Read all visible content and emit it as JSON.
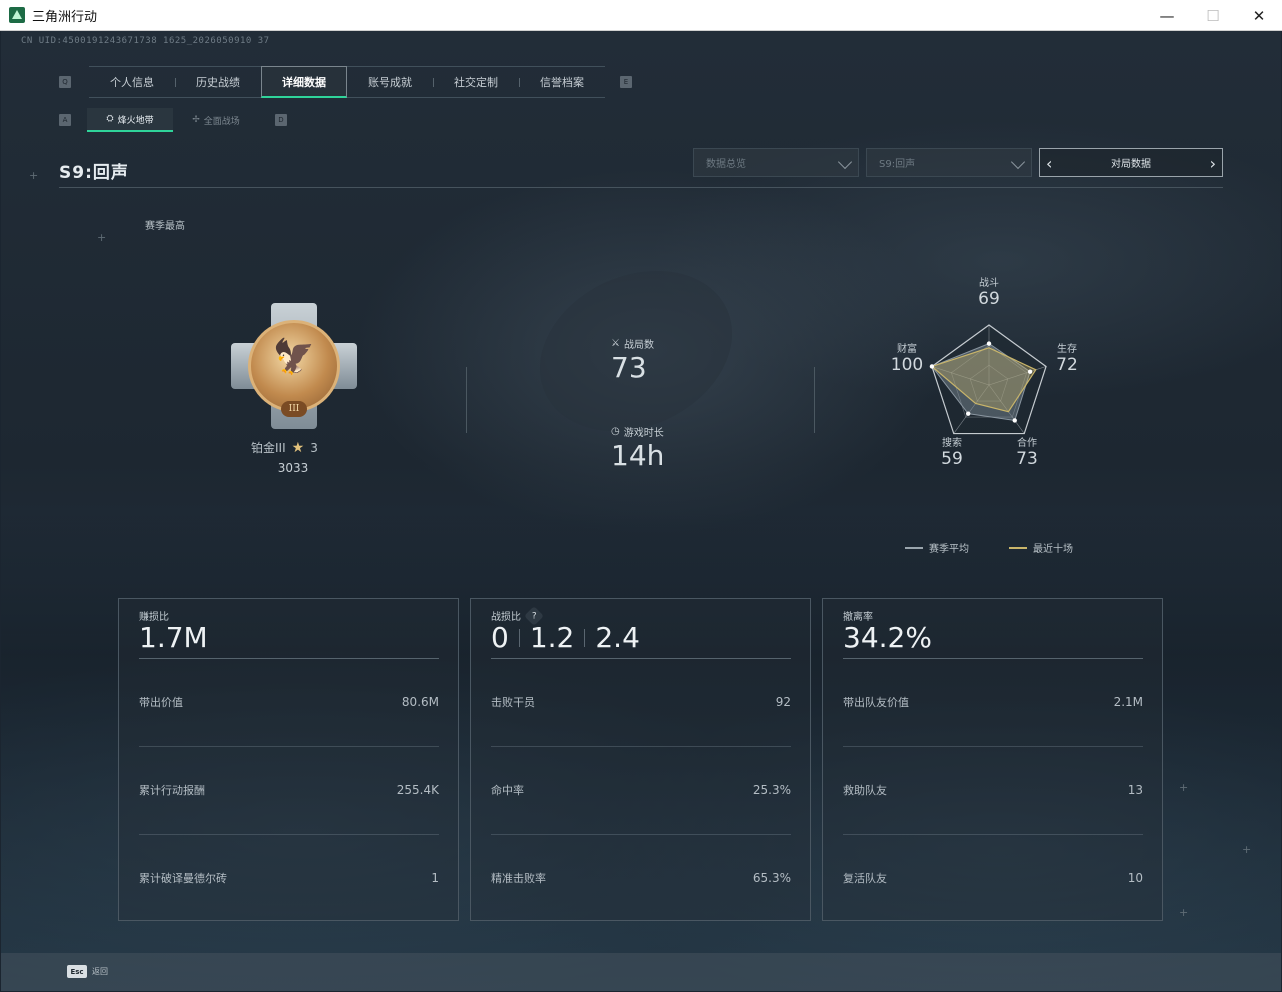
{
  "window": {
    "title": "三角洲行动",
    "minimize": "—",
    "maximize": "☐",
    "close": "✕"
  },
  "uid": "CN UID:4500191243671738 1625_2026050910 37",
  "tabs": {
    "key_left": "Q",
    "key_right": "E",
    "items": [
      {
        "label": "个人信息"
      },
      {
        "label": "历史战绩"
      },
      {
        "label": "详细数据"
      },
      {
        "label": "账号成就"
      },
      {
        "label": "社交定制"
      },
      {
        "label": "信誉档案"
      }
    ],
    "active_index": 2
  },
  "subtabs": {
    "key_left": "A",
    "key_right": "D",
    "items": [
      {
        "label": "烽火地带",
        "icon": "flame-map-icon"
      },
      {
        "label": "全面战场",
        "icon": "battlefield-icon"
      }
    ],
    "active_index": 0
  },
  "season": {
    "title": "S9:回声",
    "dropdown_overview": "数据总览",
    "dropdown_season": "S9:回声",
    "match_switch": "对局数据",
    "best_label": "赛季最高"
  },
  "rank": {
    "name": "铂金III",
    "stars": "3",
    "score": "3033",
    "medal_numeral": "III"
  },
  "overview": {
    "matches_label": "战局数",
    "matches_value": "73",
    "time_label": "游戏时长",
    "time_value": "14h"
  },
  "radar": {
    "labels": [
      "战斗",
      "生存",
      "合作",
      "搜索",
      "财富"
    ],
    "season_avg": [
      69,
      72,
      73,
      59,
      100
    ],
    "recent10_rel": [
      0.62,
      0.82,
      0.55,
      0.38,
      1.0
    ],
    "avg_color": "#8a96a0",
    "recent_color": "#c9b56a",
    "legend_avg": "赛季平均",
    "legend_recent": "最近十场"
  },
  "cards": [
    {
      "title": "赚损比",
      "main": "1.7M",
      "rows": [
        {
          "label": "带出价值",
          "value": "80.6M"
        },
        {
          "label": "累计行动报酬",
          "value": "255.4K"
        },
        {
          "label": "累计破译曼德尔砖",
          "value": "1"
        }
      ]
    },
    {
      "title": "战损比",
      "help": "?",
      "main_parts": [
        "0",
        "1.2",
        "2.4"
      ],
      "rows": [
        {
          "label": "击败干员",
          "value": "92"
        },
        {
          "label": "命中率",
          "value": "25.3%"
        },
        {
          "label": "精准击败率",
          "value": "65.3%"
        }
      ]
    },
    {
      "title": "撤离率",
      "main": "34.2%",
      "rows": [
        {
          "label": "带出队友价值",
          "value": "2.1M"
        },
        {
          "label": "救助队友",
          "value": "13"
        },
        {
          "label": "复活队友",
          "value": "10"
        }
      ]
    }
  ],
  "footer": {
    "key": "Esc",
    "label": "返回"
  }
}
